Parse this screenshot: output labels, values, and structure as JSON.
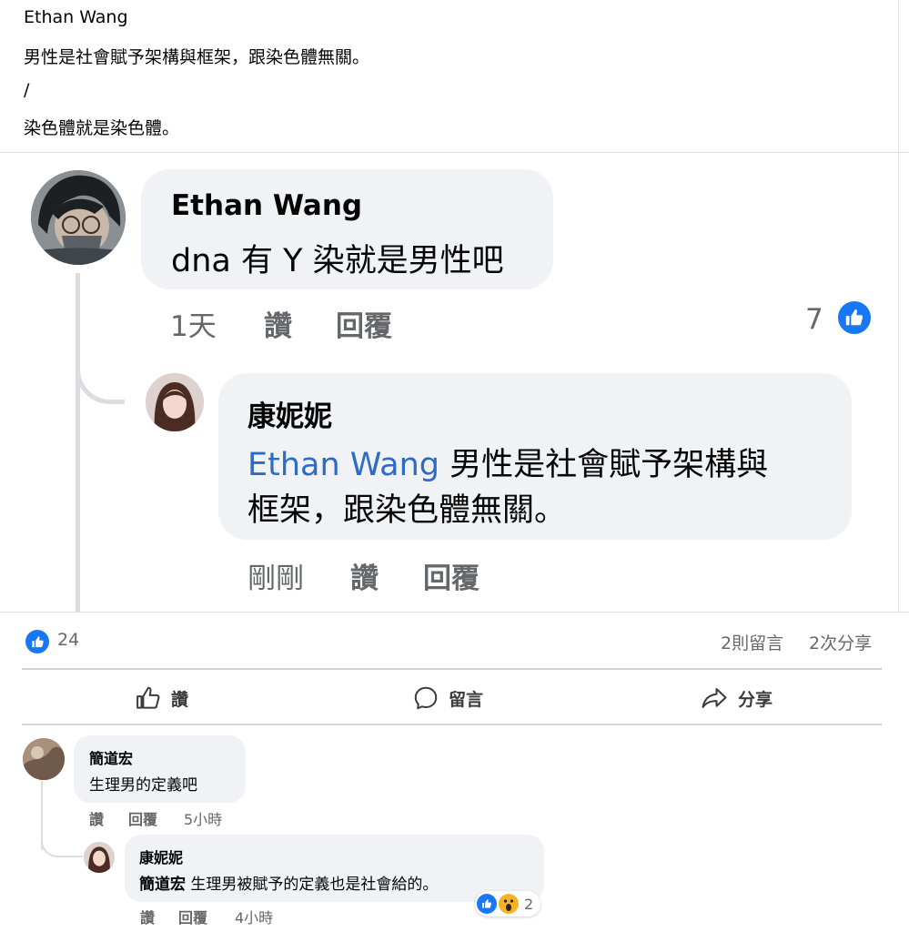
{
  "post": {
    "author": "Ethan Wang",
    "line1": "男性是社會賦予架構與框架，跟染色體無關。",
    "line2": "/",
    "line3": "染色體就是染色體。"
  },
  "zoomed_thread": {
    "comment": {
      "author": "Ethan Wang",
      "text": "dna 有 Y 染就是男性吧",
      "time": "1天",
      "like_label": "讚",
      "reply_label": "回覆",
      "reaction_count": "7"
    },
    "reply": {
      "author": "康妮妮",
      "mention": "Ethan Wang",
      "text_line1": " 男性是社會賦予架構與",
      "text_line2": "框架，跟染色體無關。",
      "time": "剛剛",
      "like_label": "讚",
      "reply_label": "回覆"
    }
  },
  "stats": {
    "reactions": "24",
    "comments": "2則留言",
    "shares": "2次分享"
  },
  "actions": {
    "like": "讚",
    "comment": "留言",
    "share": "分享"
  },
  "comments": [
    {
      "author": "簡道宏",
      "text": "生理男的定義吧",
      "like_label": "讚",
      "reply_label": "回覆",
      "time": "5小時"
    },
    {
      "author": "康妮妮",
      "mention": "簡道宏",
      "text": " 生理男被賦予的定義也是社會給的。",
      "like_label": "讚",
      "reply_label": "回覆",
      "time": "4小時",
      "reaction_count": "2"
    }
  ],
  "colors": {
    "accent": "#1877f2",
    "mention": "#2d6bc4",
    "bubble": "#f0f2f5",
    "meta": "#65676b"
  },
  "icons": [
    "like-icon",
    "comment-icon",
    "share-icon",
    "wow-icon"
  ]
}
